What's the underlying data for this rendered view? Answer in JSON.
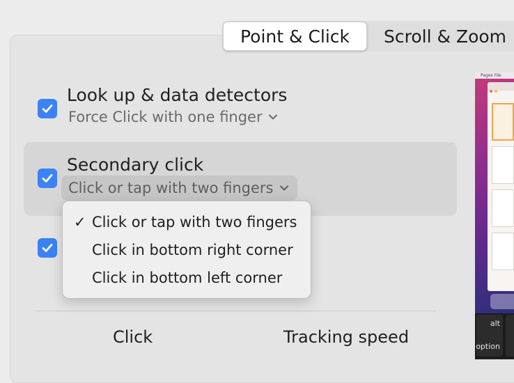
{
  "tabs": [
    {
      "label": "Point & Click",
      "active": true
    },
    {
      "label": "Scroll & Zoom",
      "active": false
    }
  ],
  "options": {
    "lookup": {
      "title": "Look up & data detectors",
      "subtitle": "Force Click with one finger",
      "checked": true
    },
    "secondary": {
      "title": "Secondary click",
      "selected_value": "Click or tap with two fingers",
      "checked": true
    },
    "third": {
      "checked": true
    }
  },
  "dropdown": {
    "items": [
      {
        "label": "Click or tap with two fingers",
        "selected": true
      },
      {
        "label": "Click in bottom right corner",
        "selected": false
      },
      {
        "label": "Click in bottom left corner",
        "selected": false
      }
    ]
  },
  "bottom": {
    "click_label": "Click",
    "tracking_label": "Tracking speed"
  },
  "preview": {
    "menubar_text": "Pages File",
    "keyboard": {
      "key1": "alt",
      "key2": "option"
    }
  },
  "colors": {
    "accent": "#3b82f6",
    "panel": "#e4e4e4",
    "highlight_row": "#d6d6d6"
  }
}
